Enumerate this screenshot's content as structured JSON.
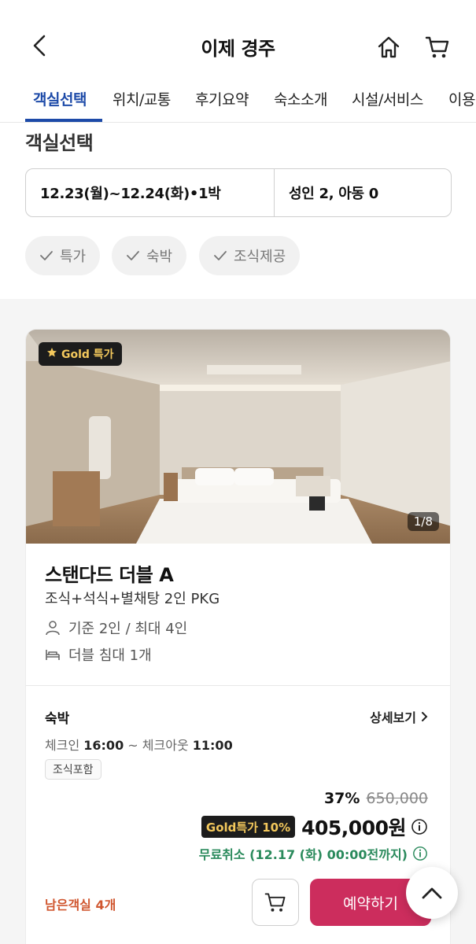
{
  "header": {
    "title": "이제 경주",
    "back_icon": "chevron-left-icon",
    "home_icon": "home-icon",
    "cart_icon": "cart-icon"
  },
  "tabs": [
    {
      "label": "객실선택",
      "active": true
    },
    {
      "label": "위치/교통"
    },
    {
      "label": "후기요약"
    },
    {
      "label": "숙소소개"
    },
    {
      "label": "시설/서비스"
    },
    {
      "label": "이용"
    }
  ],
  "section_title": "객실선택",
  "search": {
    "date_range": "12.23(월)~12.24(화)•1박",
    "guests": "성인 2, 아동 0"
  },
  "filters": [
    {
      "label": "특가",
      "checked": true
    },
    {
      "label": "숙박",
      "checked": true
    },
    {
      "label": "조식제공",
      "checked": true
    }
  ],
  "room": {
    "badge": "Gold 특가",
    "photo_counter": "1/8",
    "name": "스탠다드 더블 A",
    "package": "조식+석식+별채탕 2인 PKG",
    "capacity": "기준 2인 / 최대 4인",
    "bed": "더블 침대 1개",
    "stay_type": "숙박",
    "detail_label": "상세보기",
    "checkin_label": "체크인",
    "checkin_time": "16:00",
    "checkout_label": "~ 체크아웃",
    "checkout_time": "11:00",
    "meal_tag": "조식포함",
    "discount_pct": "37%",
    "original_price": "650,000",
    "gold_sale_label": "Gold특가 10%",
    "final_price": "405,000원",
    "cancel_policy": "무료취소 (12.17 (화) 00:00전까지)",
    "remaining": "남은객실 4개",
    "book_label": "예약하기"
  },
  "colors": {
    "accent_blue": "#1d4aa8",
    "book_pink": "#cc2d5d",
    "cancel_green": "#2a8a5c",
    "remaining_orange": "#d0562f",
    "gold": "#f3c85c"
  }
}
